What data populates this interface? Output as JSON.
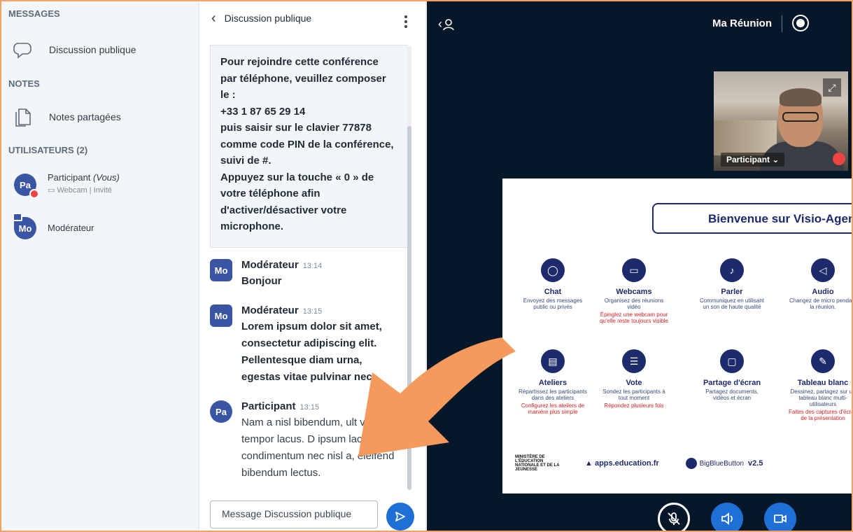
{
  "userlist": {
    "messages_title": "MESSAGES",
    "public_chat": "Discussion publique",
    "notes_title": "NOTES",
    "shared_notes": "Notes partagées",
    "users_title": "UTILISATEURS (2)",
    "users": [
      {
        "initials": "Pa",
        "name": "Participant",
        "you": "(Vous)",
        "sub": "Webcam | Invité"
      },
      {
        "initials": "Mo",
        "name": "Modérateur"
      }
    ]
  },
  "chat": {
    "title": "Discussion publique",
    "welcome": "Pour rejoindre cette conférence par téléphone, veuillez composer le :\n+33 1 87 65 29 14\npuis saisir sur le clavier 77878 comme code PIN de la conférence, suivi de #.\nAppuyez sur la touche « 0 » de votre téléphone afin d'activer/désactiver votre microphone.",
    "messages": [
      {
        "initials": "Mo",
        "author": "Modérateur",
        "time": "13:14",
        "text": "Bonjour"
      },
      {
        "initials": "Mo",
        "author": "Modérateur",
        "time": "13:15",
        "text": "Lorem ipsum dolor sit amet, consectetur adipiscing elit. Pellentesque diam urna, egestas vitae pulvinar nec,"
      },
      {
        "initials": "Pa",
        "author": "Participant",
        "time": "13:15",
        "text": "Nam a nisl bibendum, ult velit ac, tempor lacus. D ipsum lacus, condimentum nec nisl a, eleifend bibendum lectus."
      }
    ],
    "input_placeholder": "Message Discussion publique"
  },
  "meeting": {
    "title": "Ma Réunion",
    "webcam_label": "Participant",
    "slide": {
      "title": "Bienvenue sur Visio-Agent",
      "features": [
        {
          "name": "Chat",
          "desc": "Envoyez des messages public ou privés",
          "note": ""
        },
        {
          "name": "Webcams",
          "desc": "Organisez des réunions vidéo",
          "note": "Épinglez une webcam pour qu'elle reste toujours visible"
        },
        {
          "name": "Parler",
          "desc": "Communiquez en utilisant un son de haute qualité",
          "note": ""
        },
        {
          "name": "Audio",
          "desc": "Changez de micro pendant la réunion.",
          "note": ""
        },
        {
          "name": "Ateliers",
          "desc": "Répartissez les participants dans des ateliers",
          "note": "Configurez les ateliers de manière plus simple"
        },
        {
          "name": "Vote",
          "desc": "Sondez les participants à tout moment",
          "note": "Répondez plusieurs fois"
        },
        {
          "name": "Partage d'écran",
          "desc": "Partagez documents, vidéos et écran",
          "note": ""
        },
        {
          "name": "Tableau blanc",
          "desc": "Dessinez, partagez sur un tableau blanc multi-utilisateurs",
          "note": "Faites des captures d'écran de la présentation"
        }
      ],
      "ministere": "MINISTÈRE DE L'ÉDUCATION NATIONALE ET DE LA JEUNESSE",
      "apps": "apps.education.fr",
      "bbb": "BigBlueButton",
      "bbb_version": "v2.5"
    }
  }
}
